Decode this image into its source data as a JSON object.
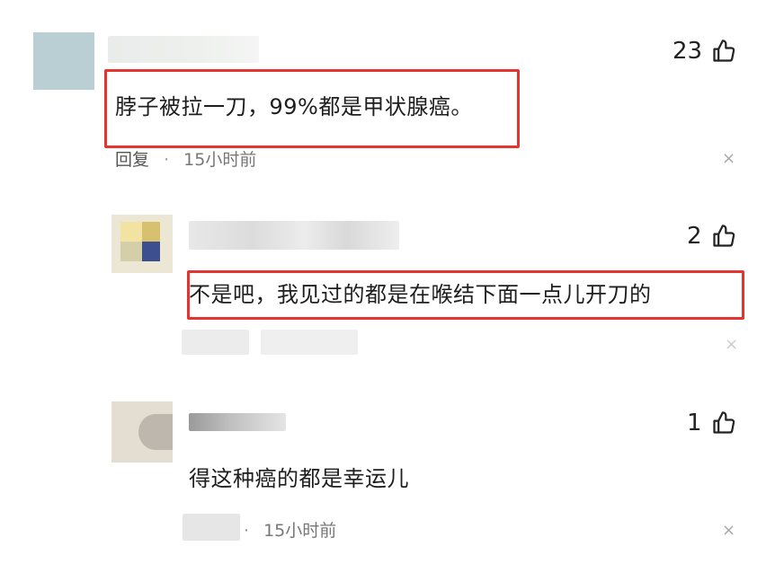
{
  "comments": [
    {
      "text": "脖子被拉一刀，99%都是甲状腺癌。",
      "likes": "23",
      "reply_label": "回复",
      "separator": "·",
      "time": "15小时前",
      "close": "×"
    },
    {
      "text": "不是吧，我见过的都是在喉结下面一点儿开刀的",
      "likes": "2",
      "close": "×"
    },
    {
      "text": "得这种癌的都是幸运儿",
      "likes": "1",
      "separator": "·",
      "time": "15小时前",
      "close": "×"
    }
  ],
  "colors": {
    "highlight_border": "#e5342f",
    "meta_text": "#777777"
  },
  "icons": [
    "thumbs-up-icon",
    "close-icon"
  ]
}
